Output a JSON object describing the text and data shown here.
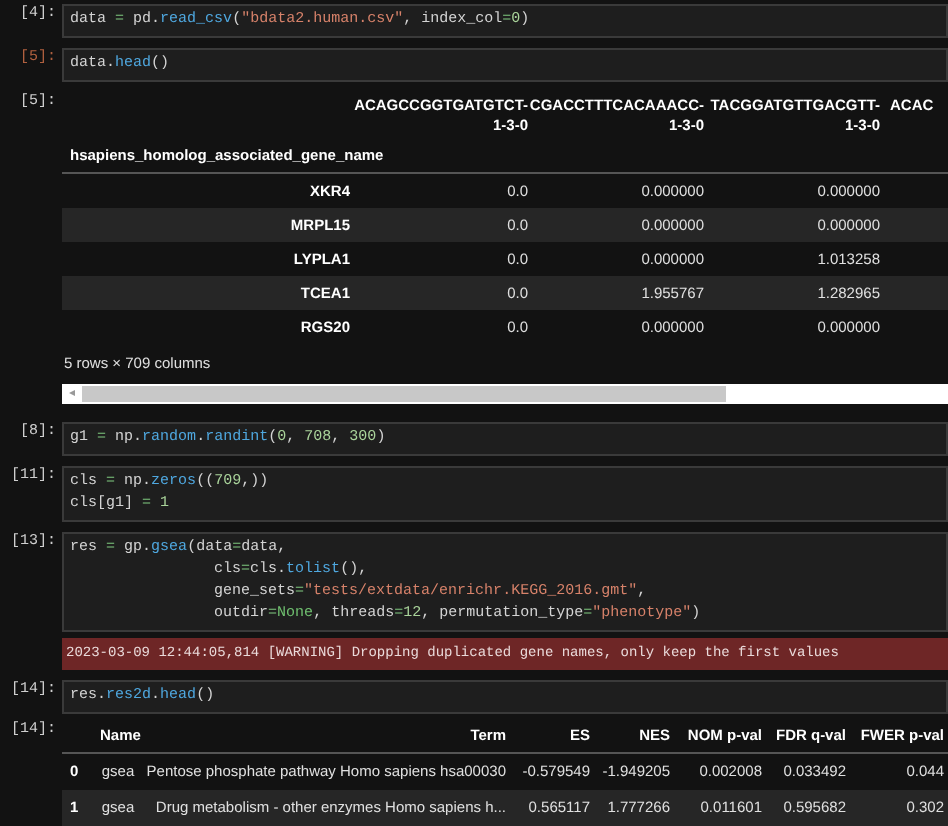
{
  "cells": [
    {
      "prompt": "[4]:",
      "active": false,
      "code": [
        [
          {
            "t": "data ",
            "kind": "plain"
          },
          {
            "t": "=",
            "kind": "operator"
          },
          {
            "t": " pd.",
            "kind": "plain"
          },
          {
            "t": "read_csv",
            "kind": "function"
          },
          {
            "t": "(",
            "kind": "plain"
          },
          {
            "t": "\"bdata2.human.csv\"",
            "kind": "string"
          },
          {
            "t": ", index_col",
            "kind": "plain"
          },
          {
            "t": "=",
            "kind": "operator"
          },
          {
            "t": "0",
            "kind": "number"
          },
          {
            "t": ")",
            "kind": "plain"
          }
        ]
      ]
    },
    {
      "prompt": "[5]:",
      "active": true,
      "code": [
        [
          {
            "t": "data.",
            "kind": "plain"
          },
          {
            "t": "head",
            "kind": "function"
          },
          {
            "t": "()",
            "kind": "plain"
          }
        ]
      ],
      "outputs": [
        {
          "kind": "wide_table",
          "prompt": "[5]:",
          "columns": [
            {
              "line1": "ACAGCCGGTGATGTCT-",
              "line2": "1-3-0"
            },
            {
              "line1": "CGACCTTTCACAAACC-",
              "line2": "1-3-0"
            },
            {
              "line1": "TACGGATGTTGACGTT-",
              "line2": "1-3-0"
            },
            {
              "line1": "ACAC"
            }
          ],
          "index_name": "hsapiens_homolog_associated_gene_name",
          "rows": [
            {
              "index": "XKR4",
              "values": [
                "0.0",
                "0.000000",
                "0.000000"
              ]
            },
            {
              "index": "MRPL15",
              "values": [
                "0.0",
                "0.000000",
                "0.000000"
              ]
            },
            {
              "index": "LYPLA1",
              "values": [
                "0.0",
                "0.000000",
                "1.013258"
              ]
            },
            {
              "index": "TCEA1",
              "values": [
                "0.0",
                "1.955767",
                "1.282965"
              ]
            },
            {
              "index": "RGS20",
              "values": [
                "0.0",
                "0.000000",
                "0.000000"
              ]
            }
          ],
          "shape": "5 rows × 709 columns",
          "scroll_arrow": "◂"
        }
      ]
    },
    {
      "prompt": "[8]:",
      "active": false,
      "code": [
        [
          {
            "t": "g1 ",
            "kind": "plain"
          },
          {
            "t": "=",
            "kind": "operator"
          },
          {
            "t": " np.",
            "kind": "plain"
          },
          {
            "t": "random",
            "kind": "function"
          },
          {
            "t": ".",
            "kind": "plain"
          },
          {
            "t": "randint",
            "kind": "function"
          },
          {
            "t": "(",
            "kind": "plain"
          },
          {
            "t": "0",
            "kind": "number"
          },
          {
            "t": ", ",
            "kind": "plain"
          },
          {
            "t": "708",
            "kind": "number"
          },
          {
            "t": ", ",
            "kind": "plain"
          },
          {
            "t": "300",
            "kind": "number"
          },
          {
            "t": ")",
            "kind": "plain"
          }
        ]
      ]
    },
    {
      "prompt": "[11]:",
      "active": false,
      "code": [
        [
          {
            "t": "cls ",
            "kind": "plain"
          },
          {
            "t": "=",
            "kind": "operator"
          },
          {
            "t": " np.",
            "kind": "plain"
          },
          {
            "t": "zeros",
            "kind": "function"
          },
          {
            "t": "((",
            "kind": "plain"
          },
          {
            "t": "709",
            "kind": "number"
          },
          {
            "t": ",))",
            "kind": "plain"
          }
        ],
        [
          {
            "t": "cls[g1] ",
            "kind": "plain"
          },
          {
            "t": "=",
            "kind": "operator"
          },
          {
            "t": " 1",
            "kind": "number"
          }
        ]
      ]
    },
    {
      "prompt": "[13]:",
      "active": false,
      "code": [
        [
          {
            "t": "res ",
            "kind": "plain"
          },
          {
            "t": "=",
            "kind": "operator"
          },
          {
            "t": " gp.",
            "kind": "plain"
          },
          {
            "t": "gsea",
            "kind": "function"
          },
          {
            "t": "(data",
            "kind": "plain"
          },
          {
            "t": "=",
            "kind": "operator"
          },
          {
            "t": "data,",
            "kind": "plain"
          }
        ],
        [
          {
            "t": "                cls",
            "kind": "plain"
          },
          {
            "t": "=",
            "kind": "operator"
          },
          {
            "t": "cls.",
            "kind": "plain"
          },
          {
            "t": "tolist",
            "kind": "function"
          },
          {
            "t": "(),",
            "kind": "plain"
          }
        ],
        [
          {
            "t": "                gene_sets",
            "kind": "plain"
          },
          {
            "t": "=",
            "kind": "operator"
          },
          {
            "t": "\"tests/extdata/enrichr.KEGG_2016.gmt\"",
            "kind": "string"
          },
          {
            "t": ",",
            "kind": "plain"
          }
        ],
        [
          {
            "t": "                outdir",
            "kind": "plain"
          },
          {
            "t": "=",
            "kind": "operator"
          },
          {
            "t": "None",
            "kind": "keyword"
          },
          {
            "t": ", threads",
            "kind": "plain"
          },
          {
            "t": "=",
            "kind": "operator"
          },
          {
            "t": "12",
            "kind": "number"
          },
          {
            "t": ", permutation_type",
            "kind": "plain"
          },
          {
            "t": "=",
            "kind": "operator"
          },
          {
            "t": "\"phenotype\"",
            "kind": "string"
          },
          {
            "t": ")",
            "kind": "plain"
          }
        ]
      ],
      "outputs": [
        {
          "kind": "warning",
          "text": "2023-03-09 12:44:05,814 [WARNING] Dropping duplicated gene names, only keep the first values"
        }
      ]
    },
    {
      "prompt": "[14]:",
      "active": false,
      "code": [
        [
          {
            "t": "res.",
            "kind": "plain"
          },
          {
            "t": "res2d",
            "kind": "function"
          },
          {
            "t": ".",
            "kind": "plain"
          },
          {
            "t": "head",
            "kind": "function"
          },
          {
            "t": "()",
            "kind": "plain"
          }
        ]
      ],
      "outputs": [
        {
          "kind": "table",
          "prompt": "[14]:",
          "columns": [
            "Name",
            "Term",
            "ES",
            "NES",
            "NOM p-val",
            "FDR q-val",
            "FWER p-val"
          ],
          "rows": [
            {
              "index": "0",
              "values": [
                "gsea",
                "Pentose phosphate pathway Homo sapiens hsa00030",
                "-0.579549",
                "-1.949205",
                "0.002008",
                "0.033492",
                "0.044"
              ]
            },
            {
              "index": "1",
              "values": [
                "gsea",
                "Drug metabolism - other enzymes Homo sapiens h...",
                "0.565117",
                "1.777266",
                "0.011601",
                "0.595682",
                "0.302"
              ]
            }
          ]
        }
      ]
    }
  ]
}
